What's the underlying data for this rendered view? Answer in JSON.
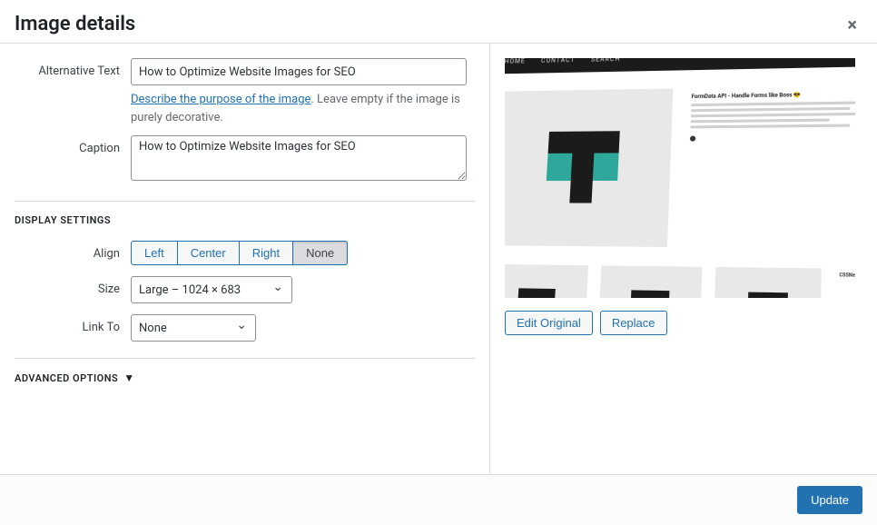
{
  "header": {
    "title": "Image details",
    "close_label": "×"
  },
  "fields": {
    "alt_label": "Alternative Text",
    "alt_value": "How to Optimize Website Images for SEO",
    "describe_link": "Describe the purpose of the image",
    "describe_suffix": ". Leave empty if the image is purely decorative.",
    "caption_label": "Caption",
    "caption_value": "How to Optimize Website Images for SEO"
  },
  "display": {
    "heading": "DISPLAY SETTINGS",
    "align_label": "Align",
    "align_options": {
      "left": "Left",
      "center": "Center",
      "right": "Right",
      "none": "None"
    },
    "align_selected": "none",
    "size_label": "Size",
    "size_value": "Large – 1024 × 683",
    "link_to_label": "Link To",
    "link_to_value": "None"
  },
  "advanced": {
    "label": "ADVANCED OPTIONS"
  },
  "preview": {
    "nav": {
      "home": "HOME",
      "contact": "CONTACT",
      "search": "SEARCH"
    },
    "card_title": "FormData API - Handle Forms like Boss 😎",
    "tile_caption": "CSSNext TurboChe",
    "edit_label": "Edit Original",
    "replace_label": "Replace"
  },
  "footer": {
    "update_label": "Update"
  }
}
